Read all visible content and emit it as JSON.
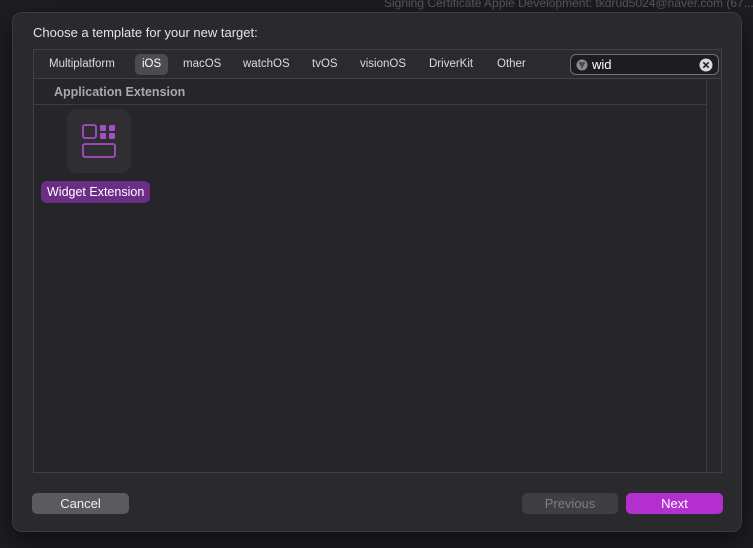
{
  "backdrop": {
    "top_text": "Signing Certificate   Apple Development: tkdrud5024@naver.com (67..."
  },
  "dialog": {
    "title": "Choose a template for your new target:"
  },
  "tabs": [
    {
      "label": "Multiplatform",
      "active": false
    },
    {
      "label": "iOS",
      "active": true
    },
    {
      "label": "macOS",
      "active": false
    },
    {
      "label": "watchOS",
      "active": false
    },
    {
      "label": "tvOS",
      "active": false
    },
    {
      "label": "visionOS",
      "active": false
    },
    {
      "label": "DriverKit",
      "active": false
    },
    {
      "label": "Other",
      "active": false
    }
  ],
  "search": {
    "value": "wid",
    "icon": "filter-icon",
    "clear_icon": "clear-icon"
  },
  "section": {
    "title": "Application Extension"
  },
  "templates": [
    {
      "label": "Widget Extension",
      "icon": "widget-icon",
      "selected": true
    }
  ],
  "buttons": {
    "cancel": "Cancel",
    "previous": "Previous",
    "next": "Next"
  },
  "colors": {
    "accent": "#b42fd0",
    "selection": "#6b2d86",
    "icon_purple": "#a44fc4"
  }
}
